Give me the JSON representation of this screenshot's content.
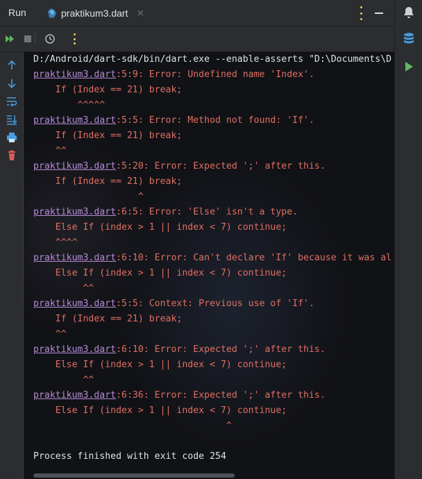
{
  "header": {
    "run_label": "Run",
    "tab": {
      "label": "praktikum3.dart",
      "close": "×"
    }
  },
  "icons": {
    "tab": "dart-file-icon",
    "toolbar": [
      "rerun-icon",
      "stop-icon",
      "history-icon",
      "more-vert-icon"
    ],
    "gutter": [
      "arrow-up-icon",
      "arrow-down-icon",
      "soft-wrap-icon",
      "scroll-to-end-icon",
      "print-icon",
      "trash-icon"
    ],
    "right_bar": [
      "notifications-icon",
      "database-icon",
      "run-icon"
    ],
    "accent_colors": {
      "error": "#df6f63",
      "link": "#b68bd8",
      "run_green": "#5fb865",
      "warning_dots": "#f2c55c",
      "action_blue": "#4a9de0",
      "delete_red": "#db5c5c"
    }
  },
  "console": {
    "command": "D:/Android/dart-sdk/bin/dart.exe --enable-asserts \"D:\\Documents\\D",
    "lines": [
      {
        "link": "praktikum3.dart",
        "text": ":5:9: Error: Undefined name 'Index'."
      },
      {
        "text": "    If (Index == 21) break;"
      },
      {
        "text": "        ^^^^^"
      },
      {
        "link": "praktikum3.dart",
        "text": ":5:5: Error: Method not found: 'If'."
      },
      {
        "text": "    If (Index == 21) break;"
      },
      {
        "text": "    ^^"
      },
      {
        "link": "praktikum3.dart",
        "text": ":5:20: Error: Expected ';' after this."
      },
      {
        "text": "    If (Index == 21) break;"
      },
      {
        "text": "                   ^"
      },
      {
        "link": "praktikum3.dart",
        "text": ":6:5: Error: 'Else' isn't a type."
      },
      {
        "text": "    Else If (index > 1 || index < 7) continue;"
      },
      {
        "text": "    ^^^^"
      },
      {
        "link": "praktikum3.dart",
        "text": ":6:10: Error: Can't declare 'If' because it was al"
      },
      {
        "text": "    Else If (index > 1 || index < 7) continue;"
      },
      {
        "text": "         ^^"
      },
      {
        "link": "praktikum3.dart",
        "text": ":5:5: Context: Previous use of 'If'."
      },
      {
        "text": "    If (Index == 21) break;"
      },
      {
        "text": "    ^^"
      },
      {
        "link": "praktikum3.dart",
        "text": ":6:10: Error: Expected ';' after this."
      },
      {
        "text": "    Else If (index > 1 || index < 7) continue;"
      },
      {
        "text": "         ^^"
      },
      {
        "link": "praktikum3.dart",
        "text": ":6:36: Error: Expected ';' after this."
      },
      {
        "text": "    Else If (index > 1 || index < 7) continue;"
      },
      {
        "text": "                                   ^"
      }
    ],
    "finish": "Process finished with exit code 254"
  }
}
